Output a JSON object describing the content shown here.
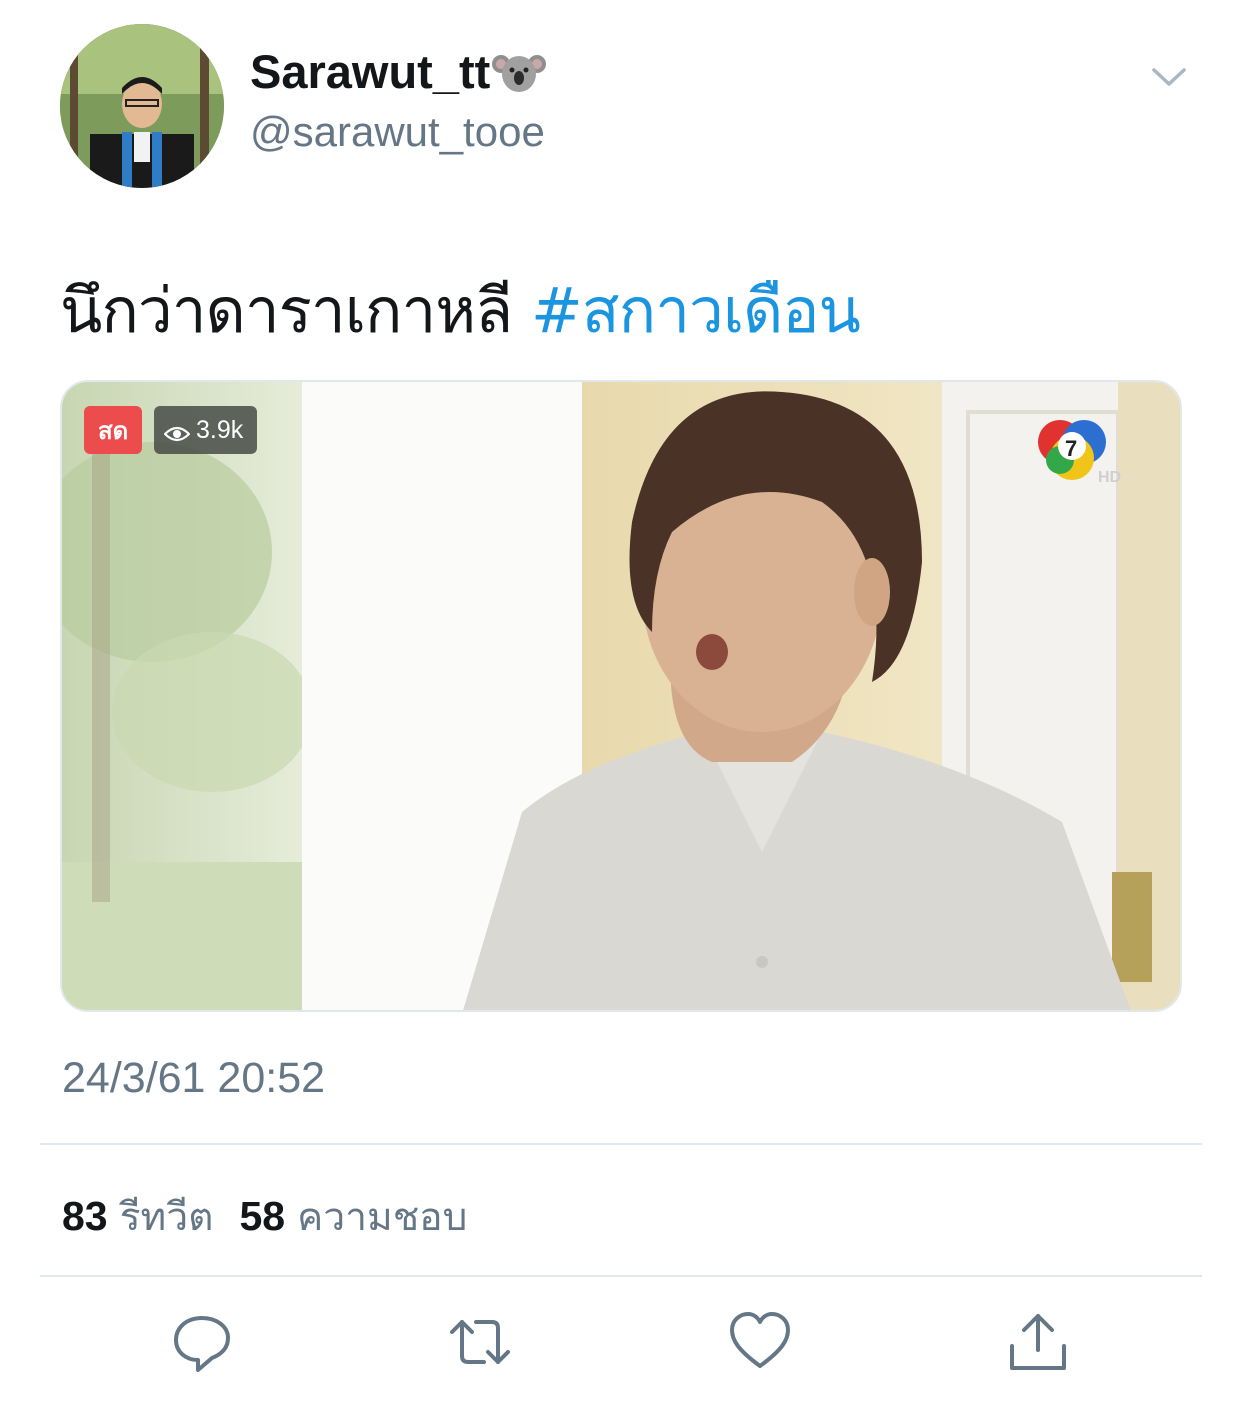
{
  "tweet": {
    "display_name": "Sarawut_tt",
    "handle": "@sarawut_tooe",
    "text": "นึกว่าดาราเกาหลี ",
    "hashtag": "#สกาวเดือน",
    "timestamp": "24/3/61 20:52"
  },
  "media": {
    "live_label": "สด",
    "view_count": "3.9k"
  },
  "stats": {
    "retweets_count": "83",
    "retweets_label": "รีทวีต",
    "likes_count": "58",
    "likes_label": "ความชอบ"
  },
  "icons": {
    "name_emoji": "koala-icon",
    "more": "chevron-down-icon",
    "reply": "reply-icon",
    "retweet": "retweet-icon",
    "like": "heart-icon",
    "share": "share-icon"
  },
  "colors": {
    "hashtag": "#1b95e0",
    "secondary_text": "#657786",
    "live_badge": "#ec4c4c",
    "divider": "#e1e8ed"
  }
}
